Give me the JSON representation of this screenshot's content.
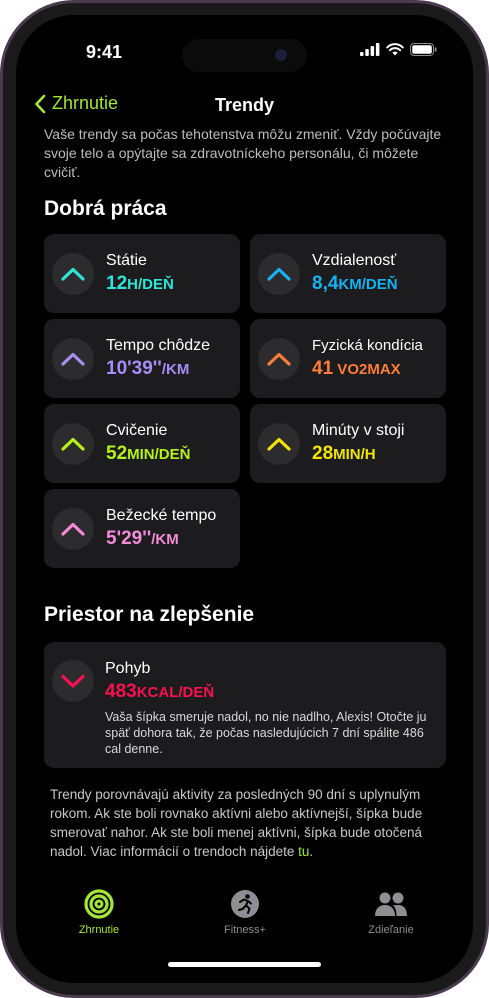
{
  "status": {
    "time": "9:41"
  },
  "nav": {
    "back_label": "Zhrnutie",
    "title": "Trendy"
  },
  "intro": "Vaše trendy sa počas tehotenstva môžu zmeniť. Vždy počúvajte svoje telo a opýtajte sa zdravotníckeho personálu, či môžete cvičiť.",
  "good": {
    "heading": "Dobrá práca",
    "items": [
      {
        "title": "Státie",
        "number": "12",
        "unit": "h/deň",
        "color": "#2ee6d6"
      },
      {
        "title": "Vzdialenosť",
        "number": "8,4",
        "unit": "km/deň",
        "color": "#17b2f2"
      },
      {
        "title": "Tempo chôdze",
        "number": "10'39''",
        "unit": "/km",
        "color": "#a98cf7"
      },
      {
        "title": "Fyzická kondícia",
        "number": "41",
        "unit": " VO2max",
        "color": "#ff7c3a"
      },
      {
        "title": "Cvičenie",
        "number": "52",
        "unit": "min/deň",
        "color": "#b4f21a"
      },
      {
        "title": "Minúty v stoji",
        "number": "28",
        "unit": "min/h",
        "color": "#f2e500"
      },
      {
        "title": "Bežecké tempo",
        "number": "5'29''",
        "unit": "/km",
        "color": "#f58ad9"
      }
    ]
  },
  "improve": {
    "heading": "Priestor na zlepšenie",
    "item": {
      "title": "Pohyb",
      "number": "483",
      "unit": "kcal/deň",
      "color": "#fa114f",
      "message": "Vaša šípka smeruje nadol, no nie nadlho, Alexis! Otočte ju späť dohora tak, že počas nasledujúcich 7 dní spálite 486 cal denne."
    }
  },
  "footer": {
    "text": "Trendy porovnávajú aktivity za posledných 90 dní s uplynulým rokom. Ak ste boli rovnako aktívni alebo aktívnejší, šípka bude smerovať nahor. Ak ste boli menej aktívni, šípka bude otočená nadol. Viac informácií o trendoch nájdete ",
    "link": "tu",
    "end": "."
  },
  "tabs": [
    {
      "label": "Zhrnutie",
      "icon": "activity-rings-icon",
      "active": true
    },
    {
      "label": "Fitness+",
      "icon": "fitness-plus-runner-icon",
      "active": false
    },
    {
      "label": "Zdieľanie",
      "icon": "sharing-people-icon",
      "active": false
    }
  ],
  "colors": {
    "accent": "#a4e634",
    "background": "#000000",
    "card": "#1c1c1e"
  }
}
